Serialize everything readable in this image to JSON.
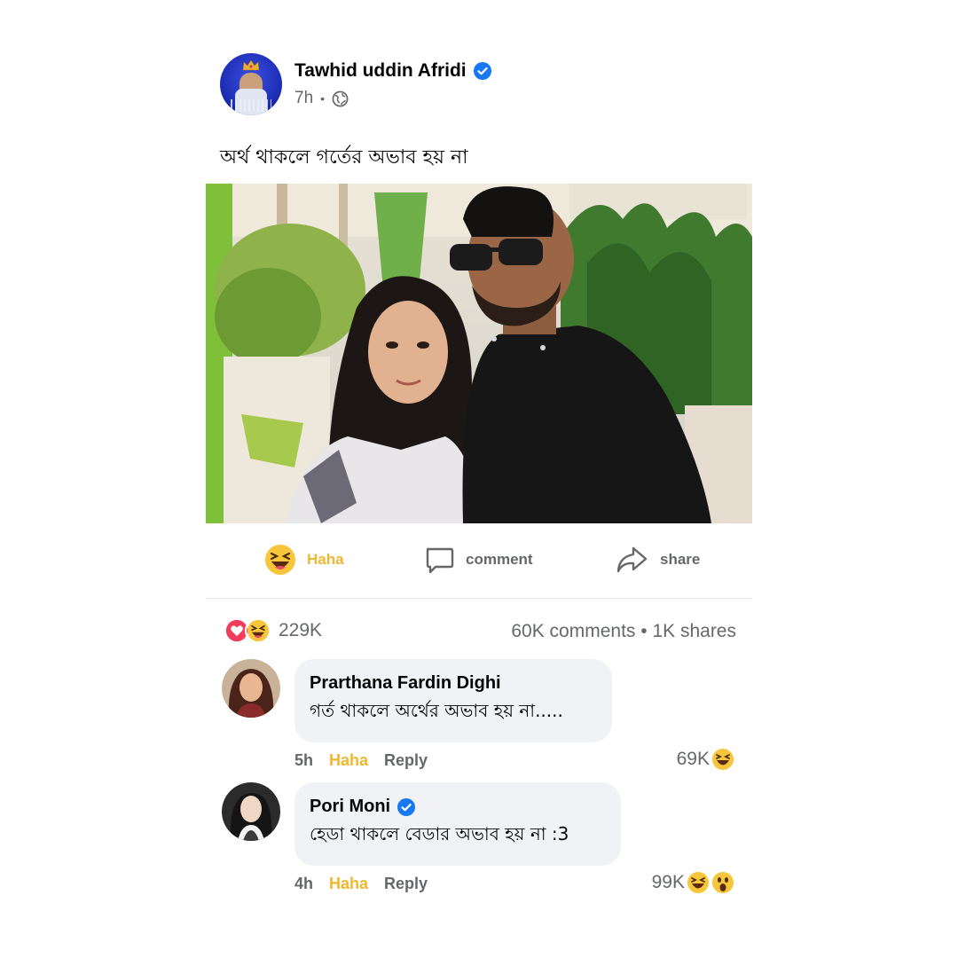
{
  "post": {
    "author": "Tawhid uddin Afridi",
    "time": "7h",
    "separator": "•",
    "text": "অর্থ থাকলে গর্তের অভাব হয় না"
  },
  "actions": {
    "haha_label": "Haha",
    "comment_label": "comment",
    "share_label": "share"
  },
  "stats": {
    "reaction_count": "229K",
    "comments_shares": "60K comments • 1K shares"
  },
  "comments": [
    {
      "name": "Prarthana Fardin Dighi",
      "text": "গর্ত থাকলে অর্থের অভাব হয় না.....",
      "time": "5h",
      "haha": "Haha",
      "reply": "Reply",
      "count": "69K"
    },
    {
      "name": "Pori Moni",
      "text": "হেডা থাকলে বেডার অভাব হয় না :3",
      "time": "4h",
      "haha": "Haha",
      "reply": "Reply",
      "count": "99K"
    }
  ],
  "colors": {
    "haha_accent": "#f0b72f",
    "verified_blue": "#1877f2",
    "secondary_text": "#65676b",
    "bubble_bg": "#f0f2f5"
  }
}
